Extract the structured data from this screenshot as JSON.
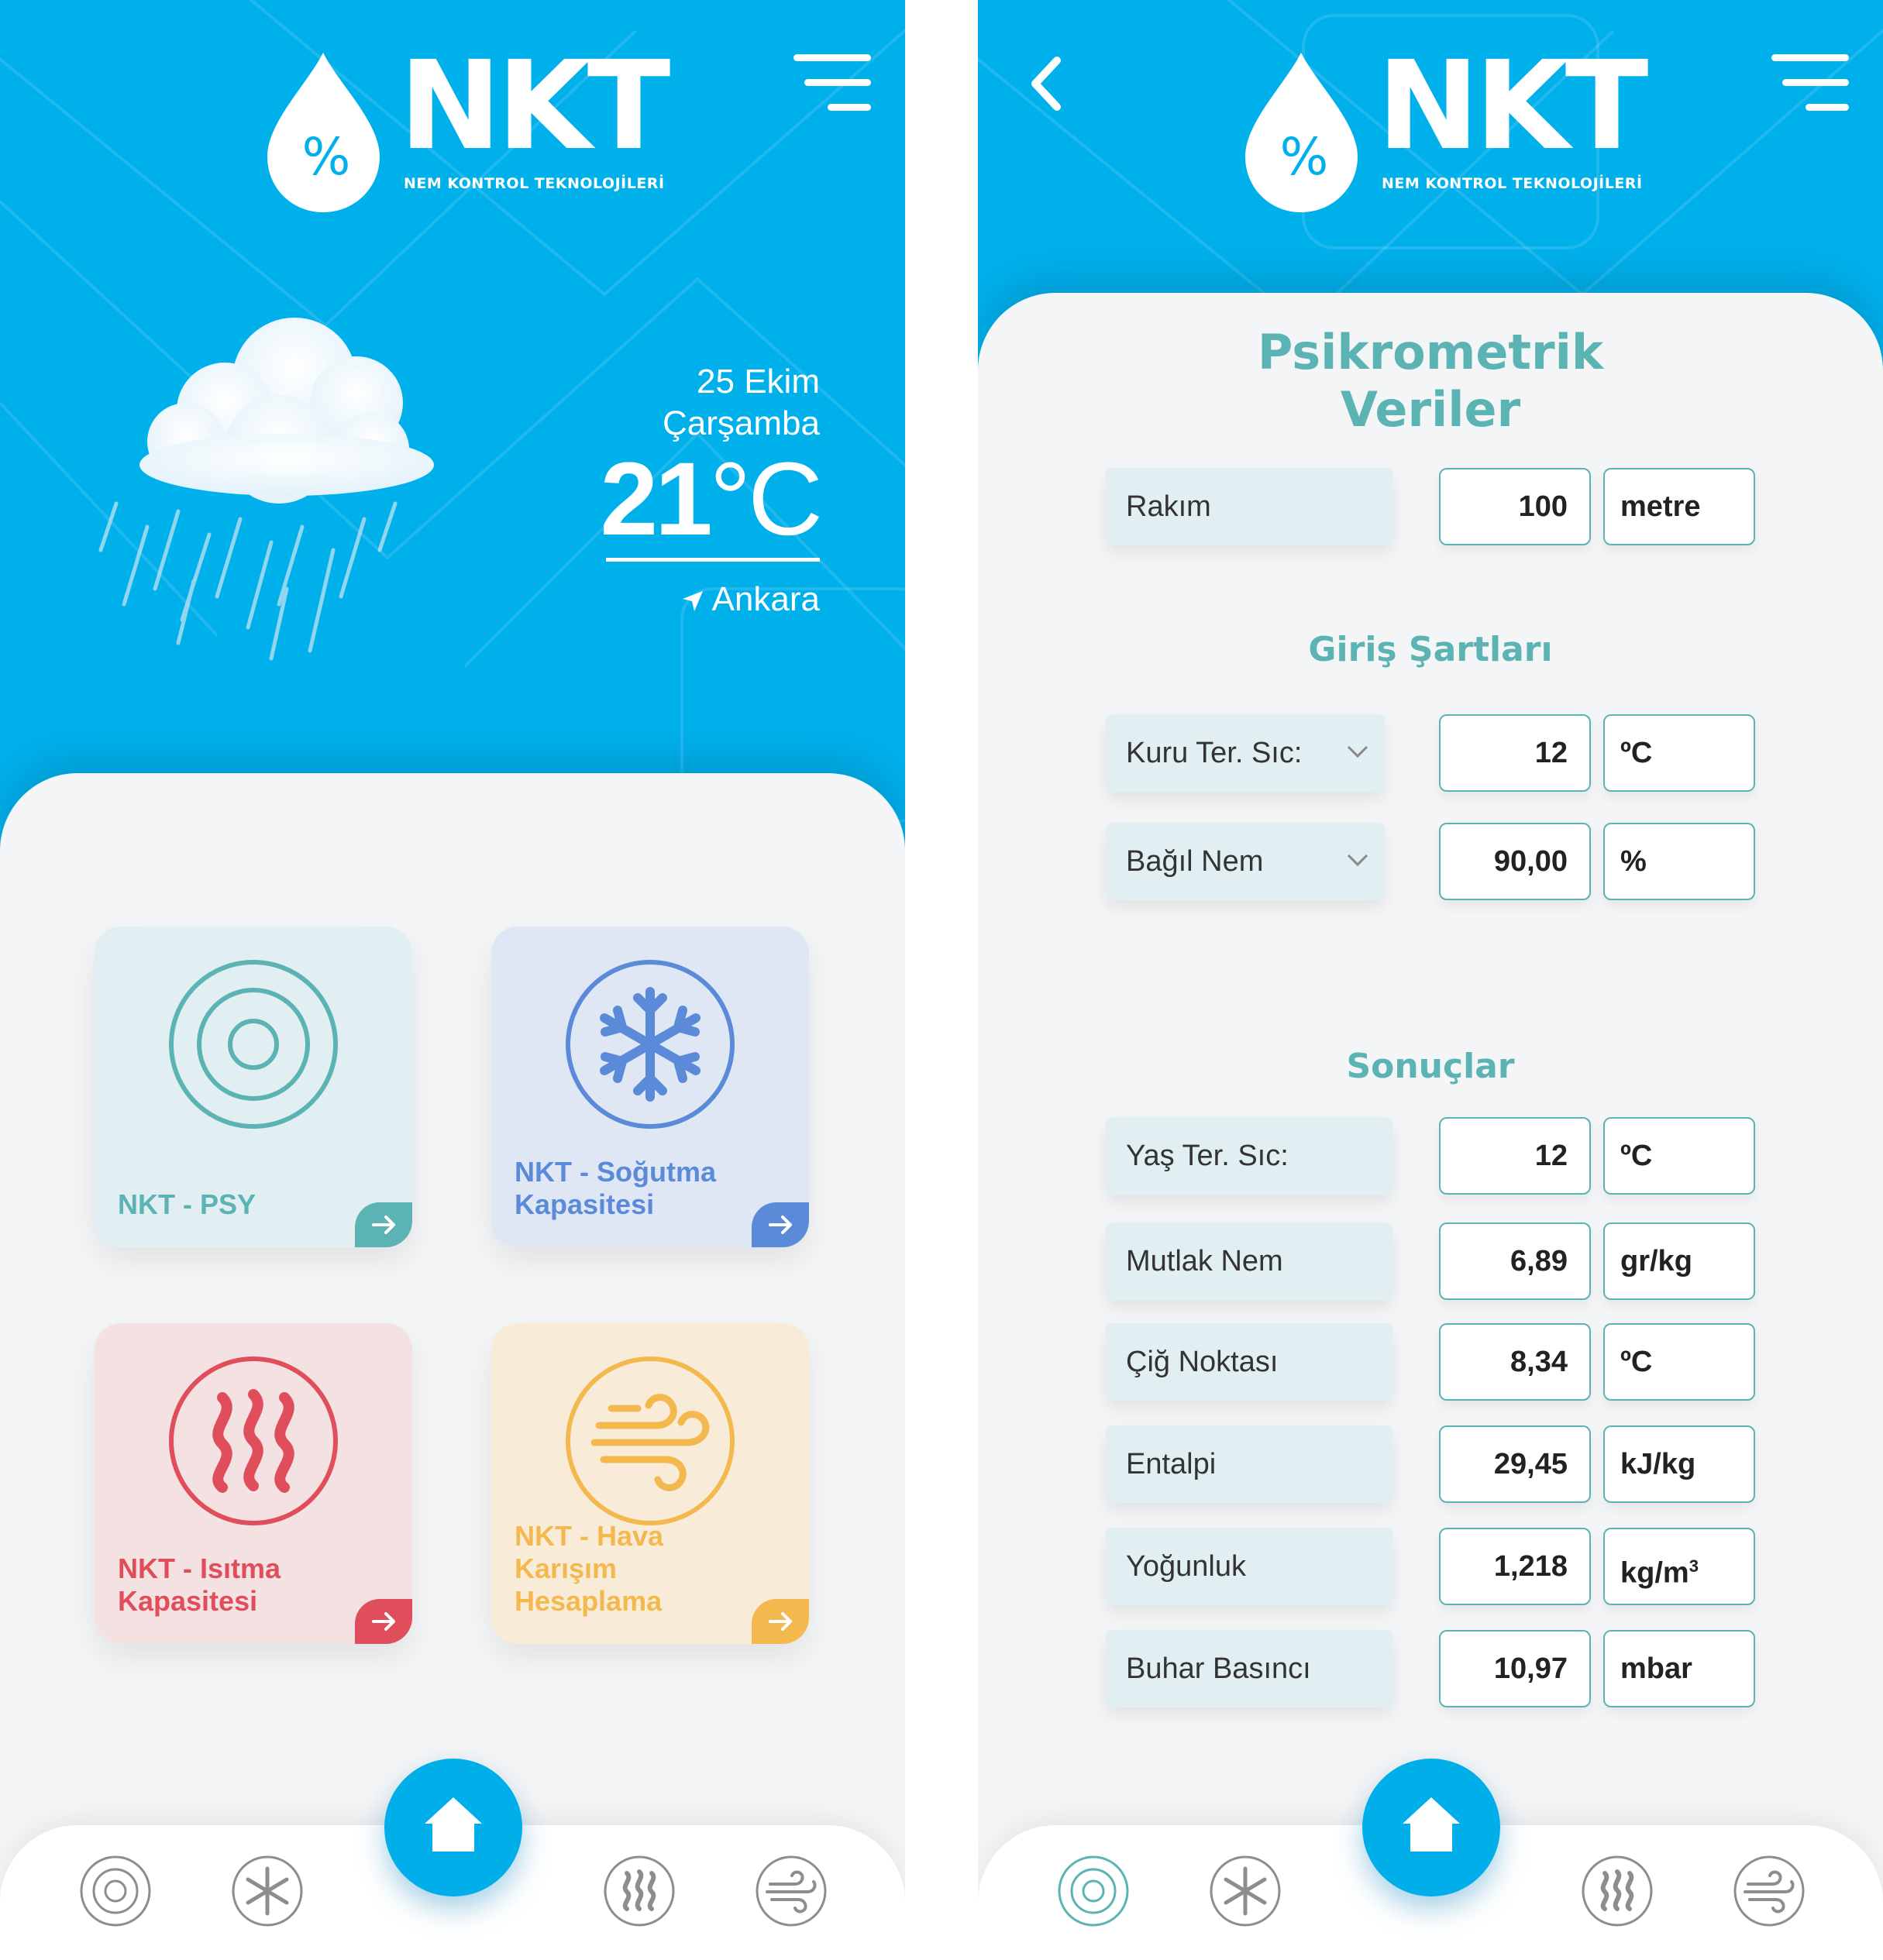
{
  "brand": {
    "logo_symbol": "%",
    "name": "NKT",
    "tagline": "NEM KONTROL TEKNOLOJİLERİ"
  },
  "colors": {
    "primary_blue": "#00b0eb",
    "teal": "#5bb3b4",
    "snow_blue": "#5b8ad8",
    "heat_red": "#e04e5c",
    "wind_yellow": "#f3b94e"
  },
  "home": {
    "weather": {
      "date": "25 Ekim",
      "day": "Çarşamba",
      "temperature": "21",
      "temperature_unit": "°C",
      "city": "Ankara",
      "icon": "rain-cloud-icon"
    },
    "tiles": [
      {
        "label": "NKT - PSY",
        "icon": "target-circles-icon"
      },
      {
        "label": "NKT - Soğutma Kapasitesi",
        "icon": "snowflake-icon"
      },
      {
        "label": "NKT - Isıtma Kapasitesi",
        "icon": "heat-waves-icon"
      },
      {
        "label": "NKT - Hava Karışım Hesaplama",
        "icon": "wind-icon"
      }
    ]
  },
  "psy": {
    "title": "Psikrometrik Veriler",
    "altitude": {
      "label": "Rakım",
      "value": "100",
      "unit": "metre"
    },
    "inputs_title": "Giriş Şartları",
    "inputs": [
      {
        "label": "Kuru Ter. Sıc:",
        "value": "12",
        "unit": "ºC"
      },
      {
        "label": "Bağıl Nem",
        "value": "90,00",
        "unit": "%"
      }
    ],
    "results_title": "Sonuçlar",
    "results": [
      {
        "label": "Yaş Ter. Sıc:",
        "value": "12",
        "unit": "ºC"
      },
      {
        "label": "Mutlak Nem",
        "value": "6,89",
        "unit": "gr/kg"
      },
      {
        "label": "Çiğ Noktası",
        "value": "8,34",
        "unit": "ºC"
      },
      {
        "label": "Entalpi",
        "value": "29,45",
        "unit": "kJ/kg"
      },
      {
        "label": "Yoğunluk",
        "value": "1,218",
        "unit": "kg/m",
        "unit_sup": "3"
      },
      {
        "label": "Buhar Basıncı",
        "value": "10,97",
        "unit": "mbar"
      }
    ]
  },
  "nav": {
    "items": [
      "psy-nav-icon",
      "cooling-nav-icon",
      "home-icon",
      "heating-nav-icon",
      "air-mix-nav-icon"
    ]
  }
}
